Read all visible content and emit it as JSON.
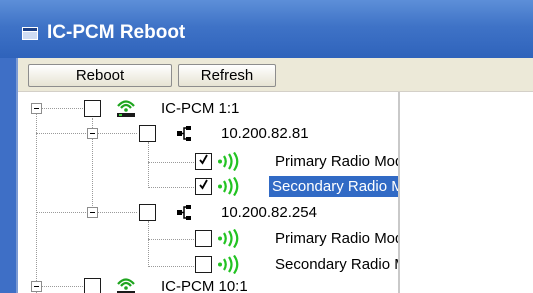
{
  "window": {
    "title": "IC-PCM Reboot"
  },
  "toolbar": {
    "reboot_label": "Reboot",
    "refresh_label": "Refresh"
  },
  "tree": {
    "nodes": [
      {
        "label": "IC-PCM 1:1",
        "icon": "wireless-router-icon",
        "checked": false
      },
      {
        "label": "10.200.82.81",
        "icon": "network-node-icon",
        "checked": false
      },
      {
        "label": "Primary Radio Module",
        "icon": "radio-waves-icon",
        "checked": true
      },
      {
        "label": "Secondary Radio Module",
        "icon": "radio-waves-icon",
        "checked": true,
        "selected": true
      },
      {
        "label": "10.200.82.254",
        "icon": "network-node-icon",
        "checked": false
      },
      {
        "label": "Primary Radio Module",
        "icon": "radio-waves-icon",
        "checked": false
      },
      {
        "label": "Secondary Radio Module",
        "icon": "radio-waves-icon",
        "checked": false
      },
      {
        "label": "IC-PCM 10:1",
        "icon": "wireless-router-icon",
        "checked": false
      }
    ]
  },
  "colors": {
    "title_bar": "#3f73c7",
    "selection": "#316ac5",
    "radio_icon": "#22c322",
    "router_icon": "#1fa51f"
  }
}
